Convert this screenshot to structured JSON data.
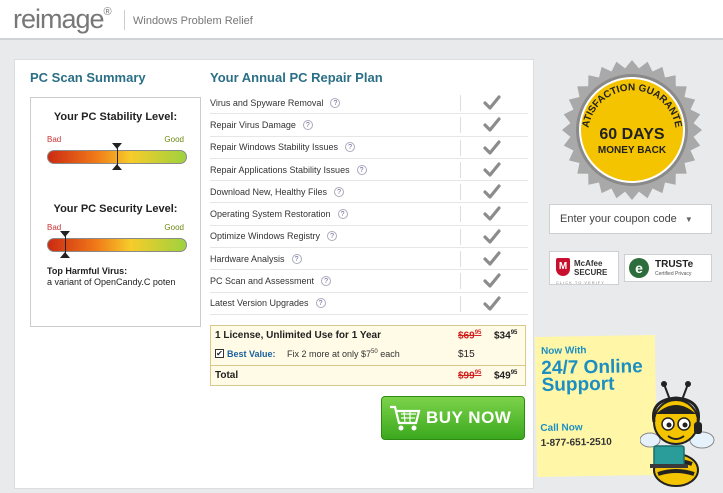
{
  "header": {
    "logo_text": "reimage",
    "logo_reg": "®",
    "tagline": "Windows Problem Relief"
  },
  "scan_summary": {
    "title": "PC Scan Summary",
    "stability": {
      "label": "Your PC Stability Level:",
      "bad": "Bad",
      "good": "Good",
      "level": 0.5
    },
    "security": {
      "label": "Your PC Security Level:",
      "bad": "Bad",
      "good": "Good",
      "level": 0.13
    },
    "virus_title": "Top Harmful Virus:",
    "virus_name": "a variant of OpenCandy.C poten"
  },
  "plan": {
    "title": "Your Annual PC Repair Plan",
    "help_glyph": "?",
    "features": [
      "Virus and Spyware Removal",
      "Repair Virus Damage",
      "Repair Windows Stability Issues",
      "Repair Applications Stability Issues",
      "Download New, Healthy Files",
      "Operating System Restoration",
      "Optimize Windows Registry",
      "Hardware Analysis",
      "PC Scan and Assessment",
      "Latest Version Upgrades"
    ]
  },
  "pricing": {
    "license_label": "1 License, Unlimited Use for 1 Year",
    "license_old": "$69",
    "license_old_cents": "95",
    "license_new": "$34",
    "license_new_cents": "95",
    "best_checked": true,
    "best_value_label": "Best Value:",
    "best_value_desc": "Fix 2 more at only $7",
    "best_value_desc_cents": "50",
    "best_value_desc_suffix": " each",
    "best_value_price": "$15",
    "total_label": "Total",
    "total_old": "$99",
    "total_old_cents": "95",
    "total_new": "$49",
    "total_new_cents": "95"
  },
  "buy_button": {
    "label": "BUY NOW"
  },
  "seal": {
    "top_text": "SATISFACTION GUARANTEE",
    "line1": "60 DAYS",
    "line2": "MONEY BACK"
  },
  "coupon": {
    "label": "Enter your coupon code",
    "arrow": "▼"
  },
  "badges": {
    "mcafee_logo": "M",
    "mcafee_name": "McAfee",
    "mcafee_secure": "SECURE",
    "mcafee_click": "CLICK TO VERIFY",
    "truste_logo": "e",
    "truste_name": "TRUSTe",
    "truste_sub": "Certified Privacy"
  },
  "support": {
    "now_with": "Now With",
    "big": "24/7 Online Support",
    "call_now": "Call Now",
    "phone": "1-877-651-2510"
  },
  "colors": {
    "accent_teal": "#2b6f86",
    "buy_green": "#3ba81e",
    "price_red": "#d21f1f",
    "seal_yellow": "#f5c400"
  }
}
